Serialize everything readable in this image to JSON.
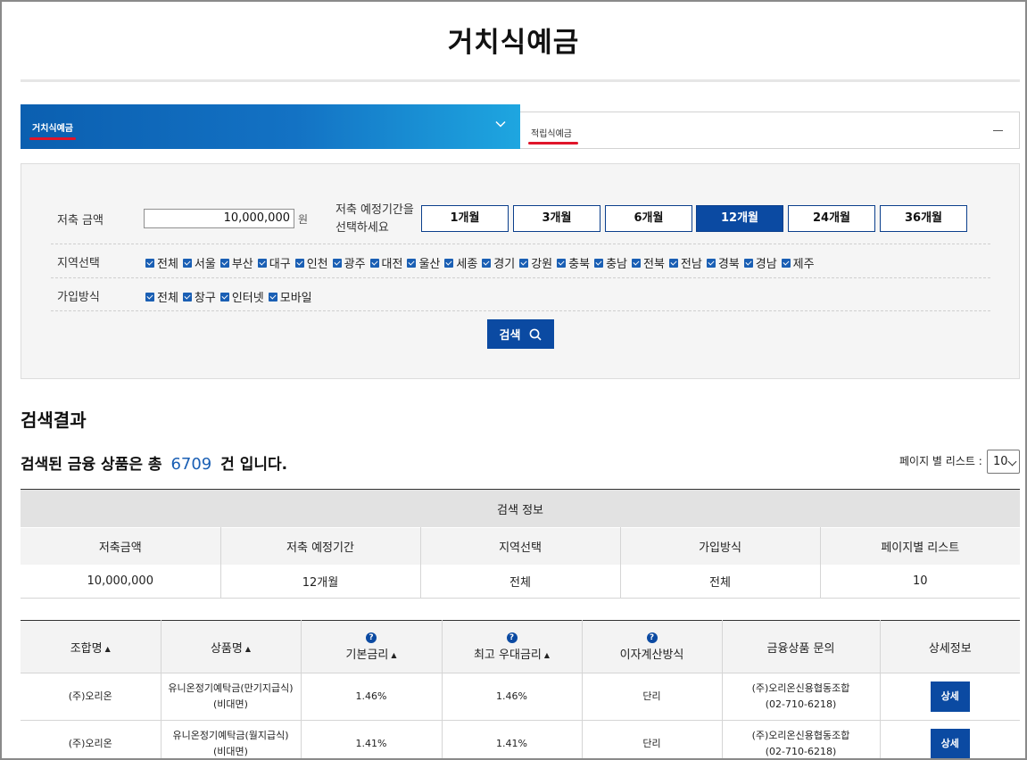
{
  "page": {
    "title": "거치식예금"
  },
  "tabs": [
    {
      "label": "거치식예금",
      "active": true
    },
    {
      "label": "적립식예금",
      "active": false
    }
  ],
  "filter": {
    "amount_label": "저축 금액",
    "amount_value": "10,000,000",
    "amount_unit": "원",
    "period_label_line1": "저축 예정기간을",
    "period_label_line2": "선택하세요",
    "periods": [
      "1개월",
      "3개월",
      "6개월",
      "12개월",
      "24개월",
      "36개월"
    ],
    "selected_period": "12개월",
    "region_label": "지역선택",
    "regions": [
      "전체",
      "서울",
      "부산",
      "대구",
      "인천",
      "광주",
      "대전",
      "울산",
      "세종",
      "경기",
      "강원",
      "충북",
      "충남",
      "전북",
      "전남",
      "경북",
      "경남",
      "제주"
    ],
    "method_label": "가입방식",
    "methods": [
      "전체",
      "창구",
      "인터넷",
      "모바일"
    ],
    "search_label": "검색"
  },
  "results": {
    "title": "검색결과",
    "count_prefix": "검색된 금융 상품은 총",
    "count": "6709",
    "count_suffix": "건 입니다.",
    "per_page_label": "페이지 별 리스트 :",
    "per_page_value": "10"
  },
  "info_table": {
    "caption": "검색 정보",
    "headers": [
      "저축금액",
      "저축 예정기간",
      "지역선택",
      "가입방식",
      "페이지별 리스트"
    ],
    "values": [
      "10,000,000",
      "12개월",
      "전체",
      "전체",
      "10"
    ]
  },
  "product_table": {
    "headers": [
      "조합명",
      "상품명",
      "기본금리",
      "최고 우대금리",
      "이자계산방식",
      "금융상품 문의",
      "상세정보"
    ],
    "rows": [
      {
        "union": "(주)오리온",
        "product_line1": "유니온정기예탁금(만기지급식)",
        "product_line2": "(비대면)",
        "base_rate": "1.46%",
        "max_rate": "1.46%",
        "interest": "단리",
        "contact_line1": "(주)오리온신용협동조합",
        "contact_line2": "(02-710-6218)",
        "detail": "상세"
      },
      {
        "union": "(주)오리온",
        "product_line1": "유니온정기예탁금(월지급식)",
        "product_line2": "(비대면)",
        "base_rate": "1.41%",
        "max_rate": "1.41%",
        "interest": "단리",
        "contact_line1": "(주)오리온신용협동조합",
        "contact_line2": "(02-710-6218)",
        "detail": "상세"
      }
    ]
  },
  "colors": {
    "primary": "#0b4aa2",
    "accent_red": "#e0152a",
    "count_blue": "#1a5fb4"
  },
  "icons": {
    "tab_chevron": "chevron-down-icon",
    "tab_collapse": "minus-icon",
    "search": "search-icon",
    "help": "question-icon",
    "sort": "sort-up-icon"
  }
}
